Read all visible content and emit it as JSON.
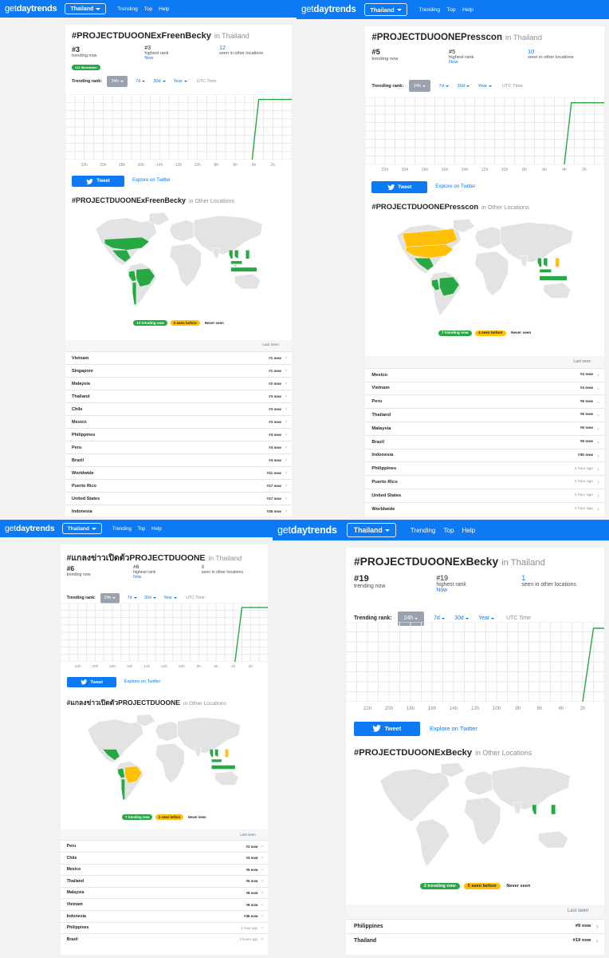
{
  "app": {
    "logo_regular": "get",
    "logo_bold": "daytrends",
    "country": "Thailand",
    "nav": [
      "Trending",
      "Top",
      "Help"
    ]
  },
  "colors": {
    "nav_blue": "#0d79f2",
    "trending_green": "#28a745",
    "seen_yellow": "#ffc107",
    "never_gray": "#e3e3e3"
  },
  "common": {
    "trending_now": "trending now",
    "highest_rank": "highest rank",
    "seen_other": "seen in other locations",
    "now": "Now",
    "trending_rank": "Trending rank:",
    "ranges": [
      "24h",
      "7d",
      "30d",
      "Year"
    ],
    "utc": "UTC Time",
    "tweet": "Tweet",
    "explore": "Explore on Twitter",
    "in_country": "in Thailand",
    "in_other": "in Other Locations",
    "never_seen": "Never seen",
    "last_seen": "Last seen",
    "x_ticks": [
      "22h",
      "20h",
      "18h",
      "16h",
      "14h",
      "12h",
      "10h",
      "8h",
      "6h",
      "4h",
      "2h"
    ]
  },
  "panels": [
    {
      "hashtag": "#PROJECTDUOONExFreenBecky",
      "rank_now": "#3",
      "worldwide_badge": "#11 Worldwide",
      "highest_rank": "#3",
      "other_locations": "12",
      "legend_trending": "13 trending now",
      "legend_seen": "0 seen before",
      "chart_data": {
        "type": "line",
        "title": "",
        "xlabel": "",
        "ylabel": "",
        "x_ticks": [
          "22h",
          "20h",
          "18h",
          "16h",
          "14h",
          "12h",
          "10h",
          "8h",
          "6h",
          "4h",
          "2h"
        ],
        "x": [
          4.2,
          4.2,
          3.5,
          2.8,
          0
        ],
        "y": [
          null,
          0,
          1,
          1,
          1
        ],
        "x_range_hours_ago": [
          24,
          0
        ],
        "grid": true
      },
      "locations": [
        {
          "name": "Vietnam",
          "rank": "#1 now"
        },
        {
          "name": "Singapore",
          "rank": "#1 now"
        },
        {
          "name": "Malaysia",
          "rank": "#2 now"
        },
        {
          "name": "Thailand",
          "rank": "#3 now"
        },
        {
          "name": "Chile",
          "rank": "#3 now"
        },
        {
          "name": "Mexico",
          "rank": "#3 now"
        },
        {
          "name": "Philippines",
          "rank": "#4 now"
        },
        {
          "name": "Peru",
          "rank": "#4 now"
        },
        {
          "name": "Brazil",
          "rank": "#4 now"
        },
        {
          "name": "Worldwide",
          "rank": "#11 now"
        },
        {
          "name": "Puerto Rico",
          "rank": "#17 now"
        },
        {
          "name": "United States",
          "rank": "#17 now"
        },
        {
          "name": "Indonesia",
          "rank": "#25 now"
        }
      ],
      "map": {
        "green": [
          "usa",
          "mexico",
          "brazil",
          "peru",
          "chile",
          "vietnam",
          "malaysia",
          "indonesia",
          "philippines",
          "thailand",
          "singapore"
        ],
        "yellow": []
      }
    },
    {
      "hashtag": "#PROJECTDUOONEPresscon",
      "rank_now": "#5",
      "worldwide_badge": "",
      "highest_rank": "#5",
      "other_locations": "10",
      "legend_trending": "7 trending now",
      "legend_seen": "4 seen before",
      "chart_data": {
        "type": "line",
        "title": "",
        "xlabel": "",
        "ylabel": "",
        "x_ticks": [
          "22h",
          "20h",
          "18h",
          "16h",
          "14h",
          "12h",
          "10h",
          "8h",
          "6h",
          "4h",
          "2h"
        ],
        "x": [
          4.0,
          4.0,
          3.3,
          0
        ],
        "y": [
          null,
          0,
          1,
          1
        ],
        "x_range_hours_ago": [
          24,
          0
        ],
        "grid": true
      },
      "locations": [
        {
          "name": "Mexico",
          "rank": "#4 now"
        },
        {
          "name": "Vietnam",
          "rank": "#4 now"
        },
        {
          "name": "Peru",
          "rank": "#5 now"
        },
        {
          "name": "Thailand",
          "rank": "#5 now"
        },
        {
          "name": "Malaysia",
          "rank": "#6 now"
        },
        {
          "name": "Brazil",
          "rank": "#9 now"
        },
        {
          "name": "Indonesia",
          "rank": "#30 now"
        },
        {
          "name": "Philippines",
          "rank": "1 hour ago"
        },
        {
          "name": "Puerto Rico",
          "rank": "1 hour ago"
        },
        {
          "name": "United States",
          "rank": "1 hour ago"
        },
        {
          "name": "Worldwide",
          "rank": "1 hour ago"
        }
      ],
      "map": {
        "green": [
          "mexico",
          "brazil",
          "peru",
          "vietnam",
          "malaysia",
          "indonesia",
          "thailand"
        ],
        "yellow": [
          "usa",
          "canada",
          "philippines"
        ]
      }
    },
    {
      "hashtag": "#แกลงข่าวเปิดตัวPROJECTDUOONE",
      "rank_now": "#6",
      "worldwide_badge": "",
      "highest_rank": "#6",
      "other_locations": "8",
      "legend_trending": "7 trending now",
      "legend_seen": "2 seen before",
      "chart_data": {
        "type": "line",
        "title": "",
        "xlabel": "",
        "ylabel": "",
        "x_ticks": [
          "22h",
          "20h",
          "18h",
          "16h",
          "14h",
          "12h",
          "10h",
          "8h",
          "6h",
          "4h",
          "2h"
        ],
        "x": [
          3.8,
          3.8,
          3.0,
          0
        ],
        "y": [
          null,
          0,
          1,
          1
        ],
        "x_range_hours_ago": [
          24,
          0
        ],
        "grid": true
      },
      "locations": [
        {
          "name": "Peru",
          "rank": "#3 now"
        },
        {
          "name": "Chile",
          "rank": "#4 now"
        },
        {
          "name": "Mexico",
          "rank": "#5 now"
        },
        {
          "name": "Thailand",
          "rank": "#6 now"
        },
        {
          "name": "Malaysia",
          "rank": "#8 now"
        },
        {
          "name": "Vietnam",
          "rank": "#8 now"
        },
        {
          "name": "Indonesia",
          "rank": "#36 now"
        },
        {
          "name": "Philippines",
          "rank": "1 hour ago"
        },
        {
          "name": "Brazil",
          "rank": "2 hours ago"
        }
      ],
      "map": {
        "green": [
          "mexico",
          "peru",
          "chile",
          "vietnam",
          "malaysia",
          "indonesia",
          "thailand"
        ],
        "yellow": [
          "brazil",
          "philippines"
        ]
      }
    },
    {
      "hashtag": "#PROJECTDUOONExBecky",
      "rank_now": "#19",
      "worldwide_badge": "",
      "highest_rank": "#19",
      "other_locations": "1",
      "legend_trending": "2 trending now",
      "legend_seen": "0 seen before",
      "chart_data": {
        "type": "line",
        "title": "",
        "xlabel": "",
        "ylabel": "",
        "x_ticks": [
          "22h",
          "20h",
          "18h",
          "16h",
          "14h",
          "12h",
          "10h",
          "8h",
          "6h",
          "4h",
          "2h"
        ],
        "x": [
          2.0,
          2.0,
          1.0,
          0
        ],
        "y": [
          null,
          0,
          1,
          1
        ],
        "x_range_hours_ago": [
          24,
          0
        ],
        "grid": true
      },
      "locations": [
        {
          "name": "Philippines",
          "rank": "#9 now"
        },
        {
          "name": "Thailand",
          "rank": "#19 now"
        }
      ],
      "map": {
        "green": [
          "thailand",
          "philippines"
        ],
        "yellow": []
      }
    }
  ]
}
